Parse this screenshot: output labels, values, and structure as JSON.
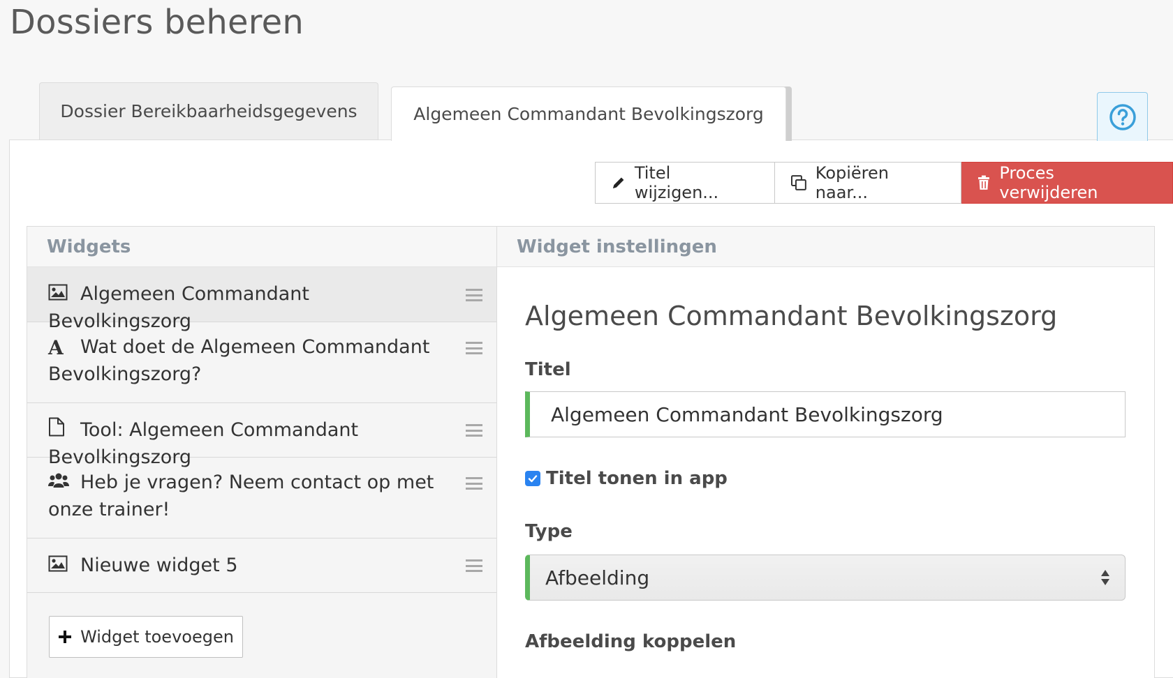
{
  "page": {
    "title": "Dossiers beheren"
  },
  "tabs": [
    {
      "label": "Dossier Bereikbaarheidsgegevens",
      "active": false
    },
    {
      "label": "Algemeen Commandant Bevolkingszorg",
      "active": true
    }
  ],
  "help": {
    "icon": "question-circle-icon"
  },
  "toolbar": {
    "edit_title_label": "Titel wijzigen...",
    "copy_label": "Kopiëren naar...",
    "delete_label": "Proces verwijderen"
  },
  "widgets": {
    "header": "Widgets",
    "items": [
      {
        "icon": "image-icon",
        "label": "Algemeen Commandant Bevolkingszorg"
      },
      {
        "icon": "font-icon",
        "label": "Wat doet de Algemeen Commandant Bevolkingszorg?"
      },
      {
        "icon": "file-icon",
        "label": "Tool: Algemeen Commandant Bevolkingszorg"
      },
      {
        "icon": "users-icon",
        "label": "Heb je vragen? Neem contact op met onze trainer!"
      },
      {
        "icon": "image-icon",
        "label": "Nieuwe widget 5"
      }
    ],
    "add_label": "Widget toevoegen"
  },
  "settings": {
    "header": "Widget instellingen",
    "title": "Algemeen Commandant Bevolkingszorg",
    "titel_label": "Titel",
    "titel_value": "Algemeen Commandant Bevolkingszorg",
    "show_title_label": "Titel tonen in app",
    "show_title_checked": true,
    "type_label": "Type",
    "type_value": "Afbeelding",
    "image_label": "Afbeelding koppelen"
  },
  "colors": {
    "danger": "#d9534f",
    "success_accent": "#5cb85c",
    "checkbox": "#2a83f0",
    "help_accent": "#3a9fd9"
  }
}
